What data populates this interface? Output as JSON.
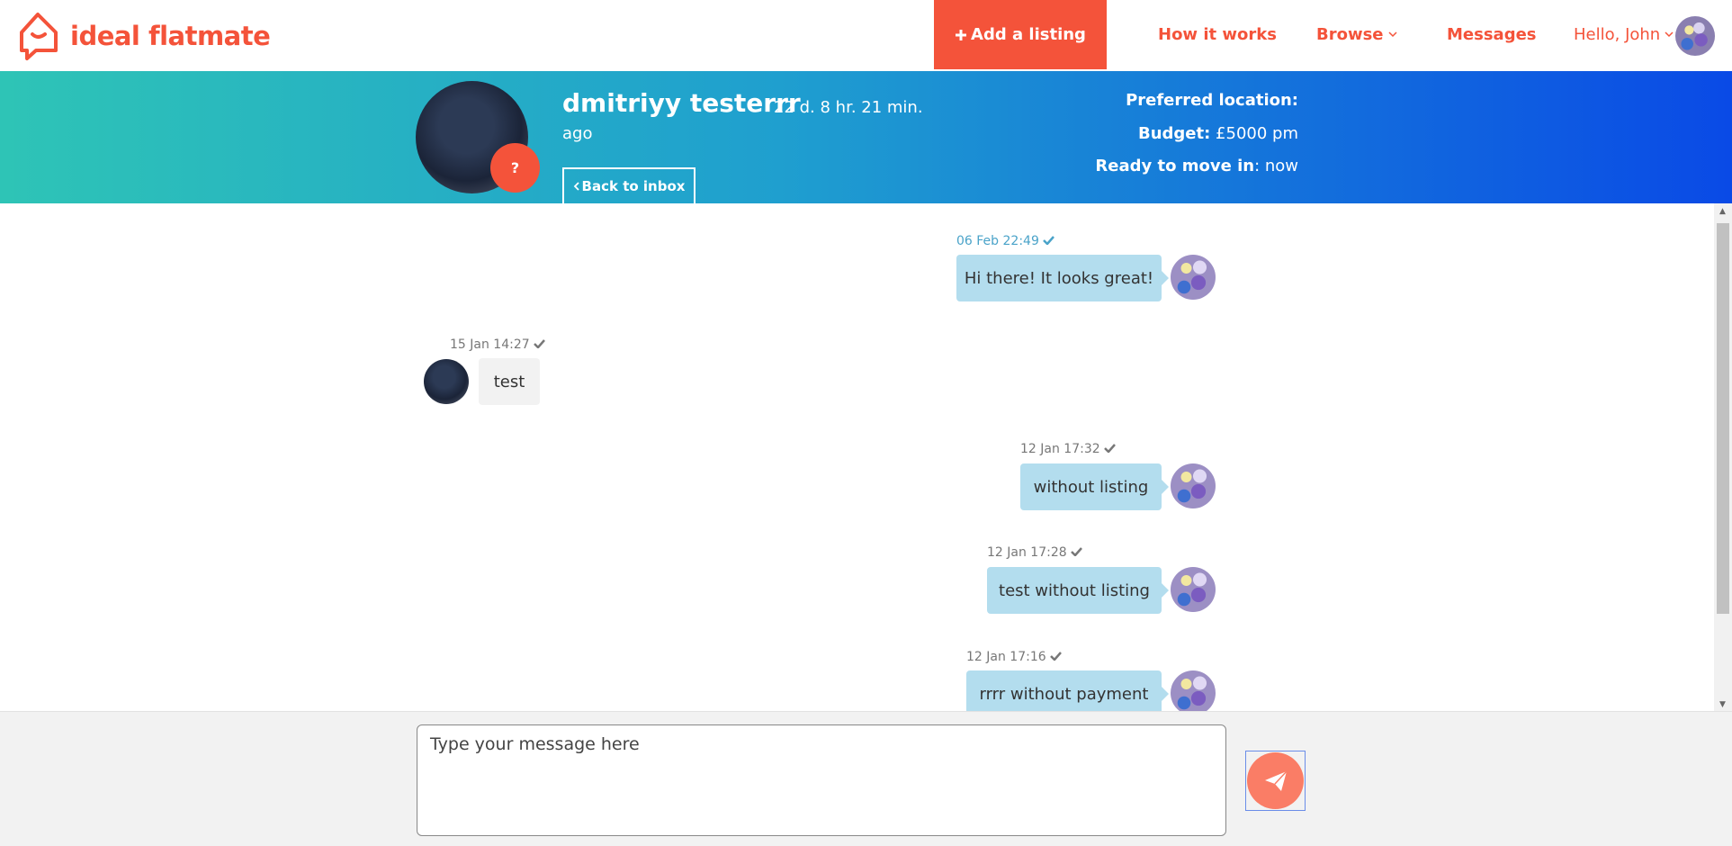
{
  "brand": {
    "name": "ideal flatmate",
    "color": "#f4533a"
  },
  "nav": {
    "add_listing": "Add a listing",
    "how_it_works": "How it works",
    "browse": "Browse",
    "messages": "Messages",
    "greeting": "Hello, John"
  },
  "profile": {
    "name": "dmitriyy testerrr",
    "last_seen": "22 d. 8 hr. 21 min.",
    "last_seen_suffix": "ago",
    "badge": "?",
    "back_label": "Back to inbox",
    "preferred_location_label": "Preferred location:",
    "preferred_location_value": "",
    "budget_label": "Budget:",
    "budget_value": "£5000 pm",
    "move_in_label": "Ready to move in",
    "move_in_value": ": now"
  },
  "messages": [
    {
      "direction": "out",
      "time": "06 Feb 22:49",
      "text": "Hi there! It looks great!",
      "read": true
    },
    {
      "direction": "in",
      "time": "15 Jan 14:27",
      "text": "test",
      "read": true
    },
    {
      "direction": "out",
      "time": "12 Jan 17:32",
      "text": "without listing",
      "read": true
    },
    {
      "direction": "out",
      "time": "12 Jan 17:28",
      "text": "test without listing",
      "read": true
    },
    {
      "direction": "out",
      "time": "12 Jan 17:16",
      "text": "rrrr without payment",
      "read": true
    }
  ],
  "composer": {
    "placeholder": "Type your message here"
  },
  "icons": {
    "logo": "house-chat-icon",
    "plus": "plus-icon",
    "chevron": "chevron-down-icon",
    "check": "check-icon",
    "back": "chevron-left-icon",
    "send": "paper-plane-icon"
  },
  "colors": {
    "accent": "#f4533a",
    "banner_start": "#2ec4b6",
    "banner_end": "#0a4ae6",
    "outgoing_bubble": "#b3ddee",
    "incoming_bubble": "#f2f2f2",
    "send_button": "#fa7d66"
  }
}
